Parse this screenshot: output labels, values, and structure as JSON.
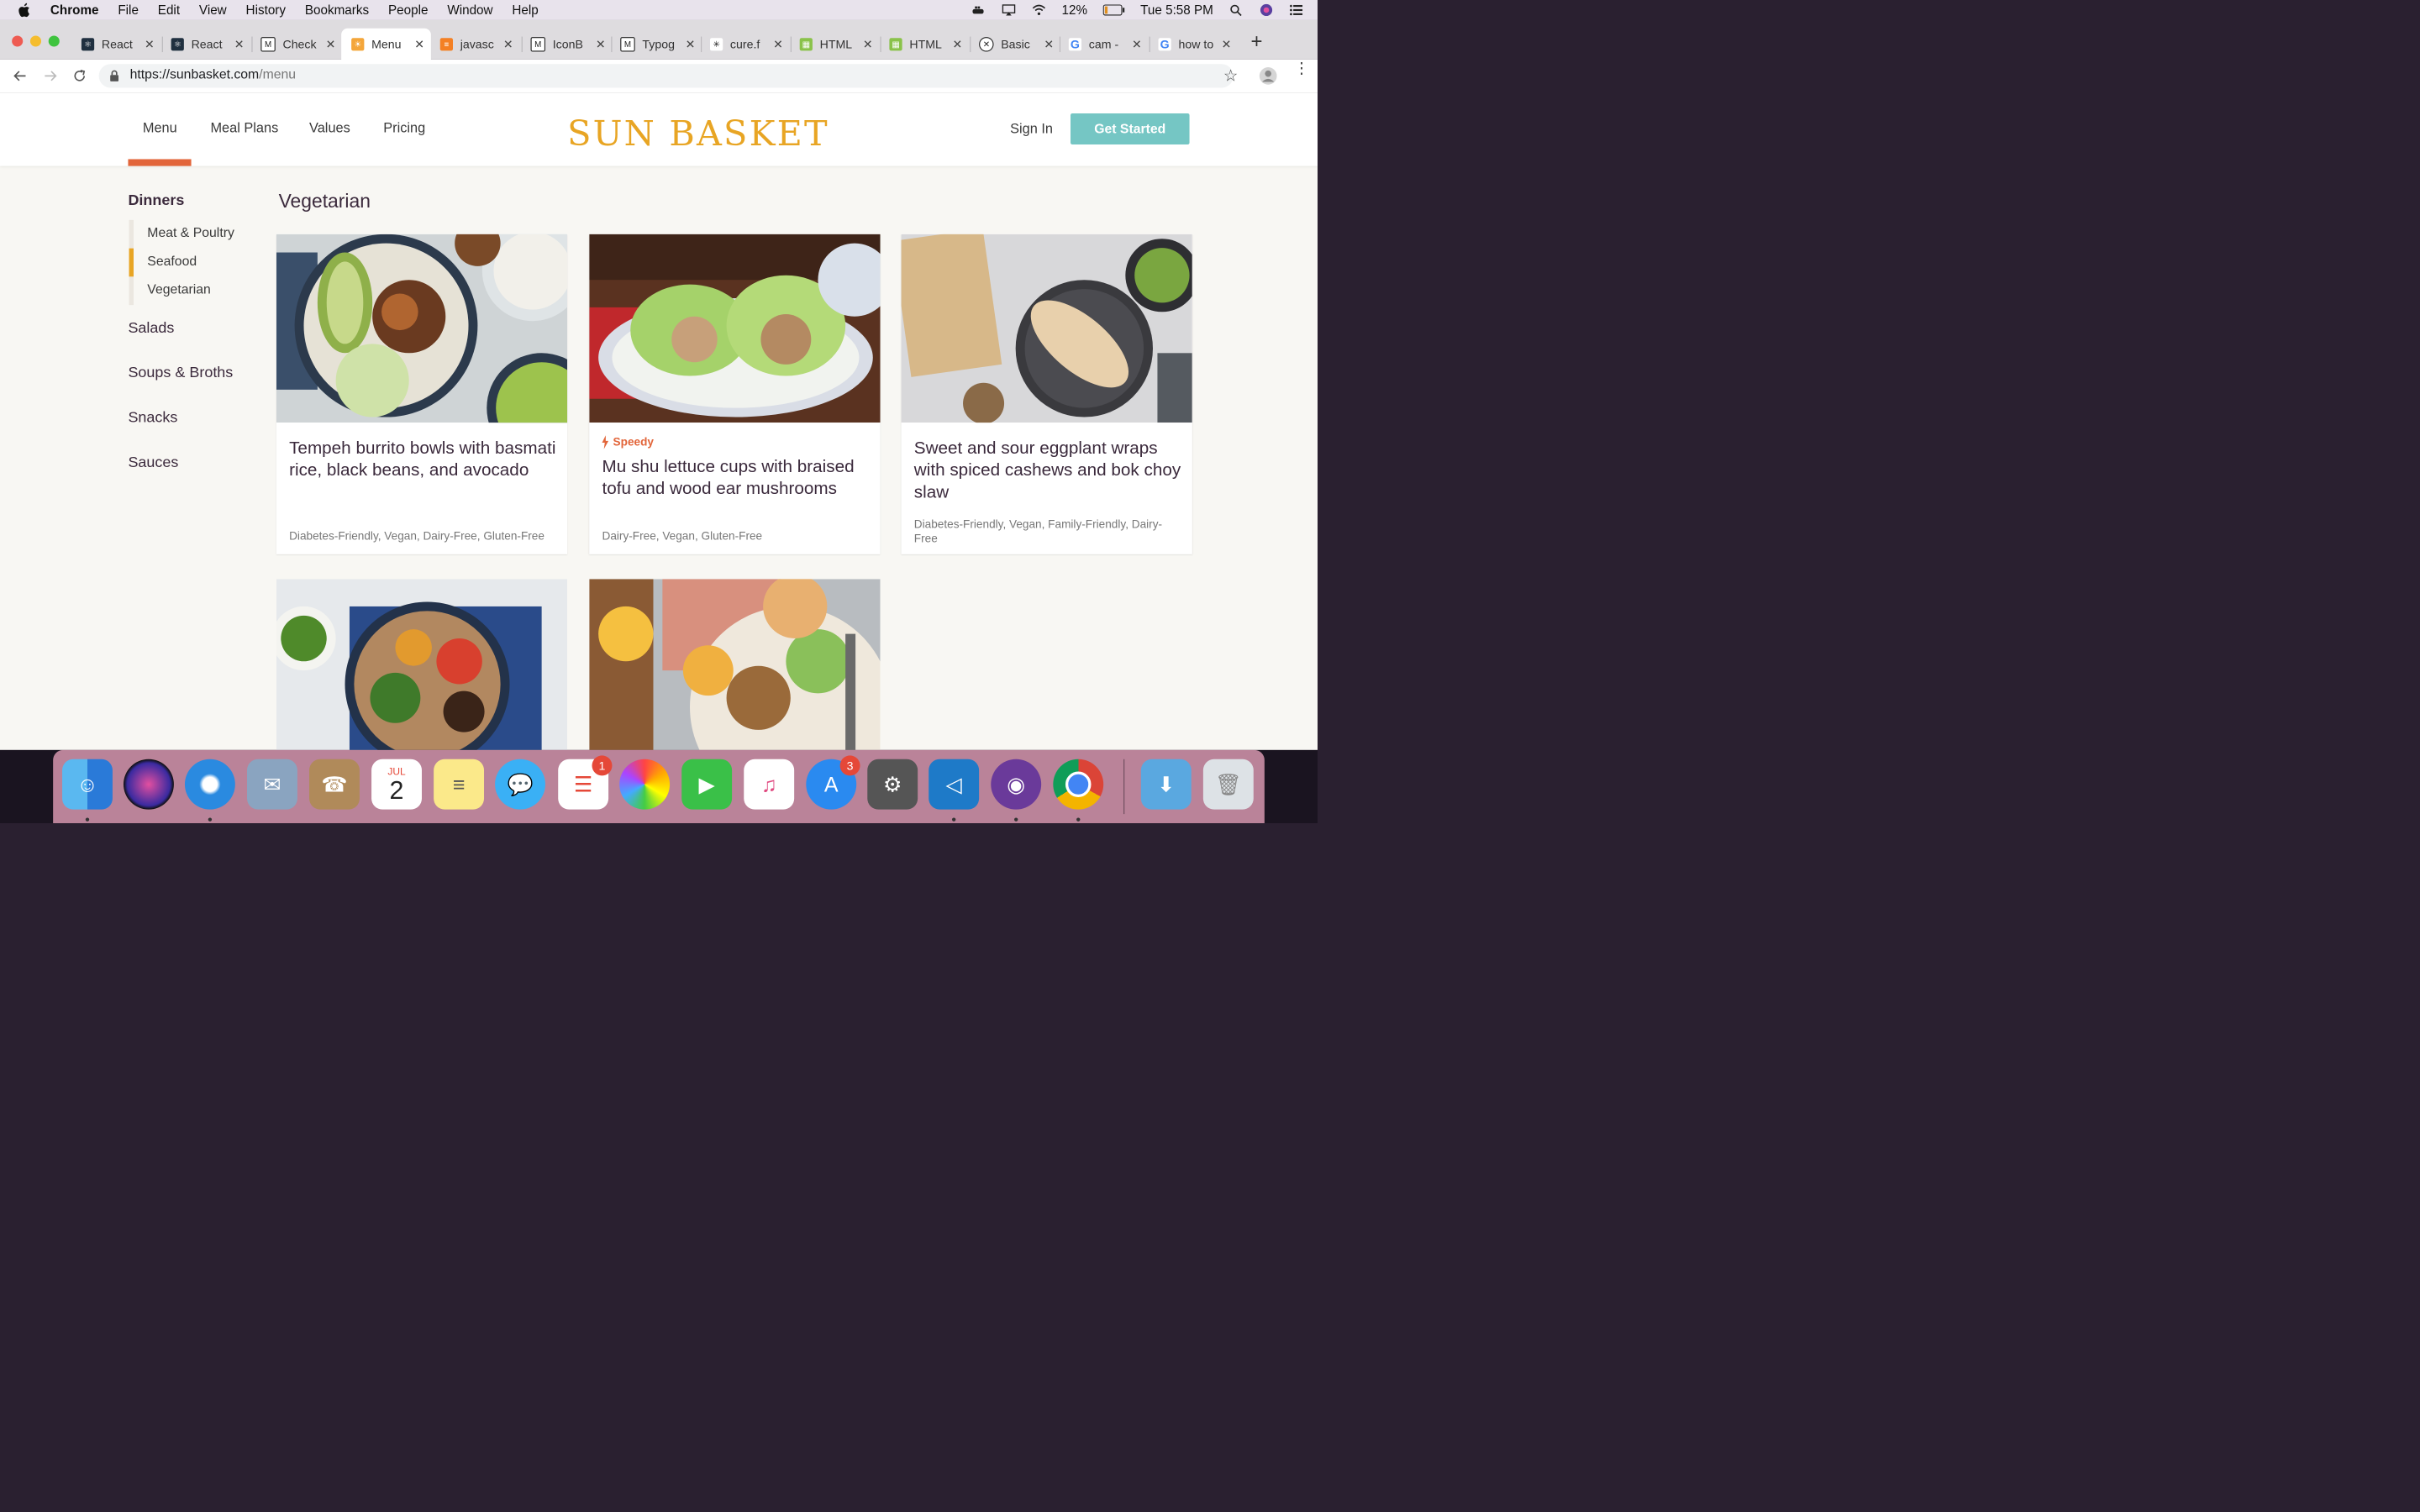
{
  "menubar": {
    "items": [
      "Chrome",
      "File",
      "Edit",
      "View",
      "History",
      "Bookmarks",
      "People",
      "Window",
      "Help"
    ],
    "battery": "12%",
    "clock": "Tue 5:58 PM"
  },
  "tabs": [
    {
      "label": "React",
      "icon": "react-icon"
    },
    {
      "label": "React",
      "icon": "react-icon"
    },
    {
      "label": "Check",
      "icon": "logo-icon"
    },
    {
      "label": "Menu",
      "icon": "sunbasket-icon",
      "active": true
    },
    {
      "label": "javasc",
      "icon": "stackoverflow-icon"
    },
    {
      "label": "IconB",
      "icon": "logo-icon"
    },
    {
      "label": "Typog",
      "icon": "logo-icon"
    },
    {
      "label": "cure.f",
      "icon": "asterisk-icon"
    },
    {
      "label": "HTML",
      "icon": "html-icon"
    },
    {
      "label": "HTML",
      "icon": "html-icon"
    },
    {
      "label": "Basic",
      "icon": "x-circle-icon"
    },
    {
      "label": "cam -",
      "icon": "google-icon"
    },
    {
      "label": "how to",
      "icon": "google-icon"
    }
  ],
  "address": {
    "host": "https://sunbasket.com",
    "path": "/menu"
  },
  "site": {
    "nav": [
      "Menu",
      "Meal Plans",
      "Values",
      "Pricing"
    ],
    "logo": "SUN BASKET",
    "sign_in": "Sign In",
    "get_started": "Get Started",
    "accent": "#e2653a",
    "brand": "#e8a524",
    "cta": "#75c6c4"
  },
  "sidebar": {
    "heading": "Dinners",
    "subitems": [
      "Meat & Poultry",
      "Seafood",
      "Vegetarian"
    ],
    "active_subitem": "Seafood",
    "categories": [
      "Salads",
      "Soups & Broths",
      "Snacks",
      "Sauces"
    ]
  },
  "main": {
    "section_title": "Vegetarian",
    "recipes": [
      {
        "title": "Tempeh burrito bowls with basmati rice, black beans, and avocado",
        "badge": "",
        "tags": "Diabetes-Friendly, Vegan, Dairy-Free, Gluten-Free"
      },
      {
        "title": "Mu shu lettuce cups with braised tofu and wood ear mushrooms",
        "badge": "Speedy",
        "tags": "Dairy-Free, Vegan, Gluten-Free"
      },
      {
        "title": "Sweet and sour eggplant wraps with spiced cashews and bok choy slaw",
        "badge": "",
        "tags": "Diabetes-Friendly, Vegan, Family-Friendly, Dairy-Free"
      }
    ]
  },
  "dock": {
    "apps": [
      "Finder",
      "Siri",
      "Safari",
      "Mail",
      "Contacts",
      "Calendar",
      "Notes",
      "Messages",
      "Reminders",
      "Photos",
      "FaceTime",
      "iTunes",
      "App Store",
      "System Preferences",
      "Visual Studio Code",
      "GitHub Desktop",
      "Chrome",
      "Downloads",
      "Trash"
    ],
    "calendar_month": "JUL",
    "calendar_day": "2",
    "reminders_badge": "1",
    "appstore_badge": "3"
  }
}
